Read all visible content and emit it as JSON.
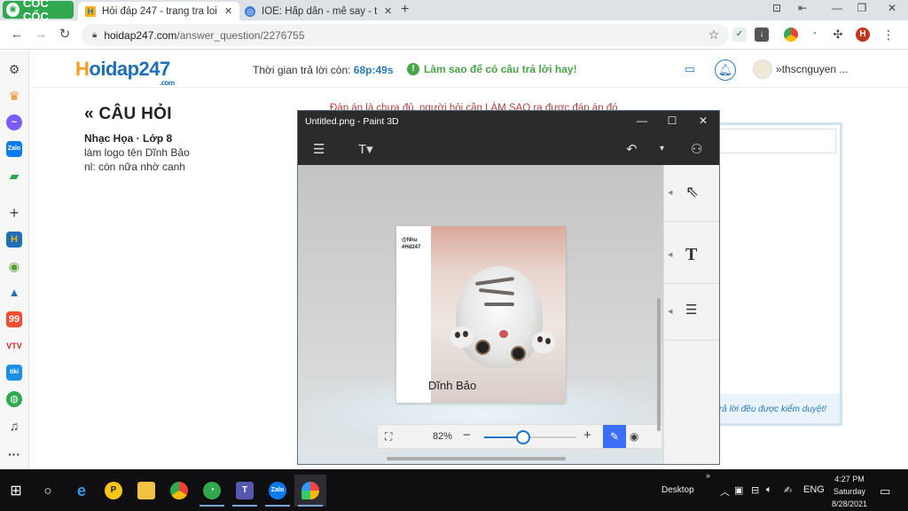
{
  "browser": {
    "brand": "CỐC CỐC",
    "tabs": [
      {
        "title": "Hỏi đáp 247 - trang tra loi",
        "active": true
      },
      {
        "title": "IOE: Hấp dẫn - mê say - thấy",
        "active": false
      }
    ],
    "url_host": "hoidap247.com",
    "url_path": "/answer_question/2276755",
    "profile_initial": "H"
  },
  "site": {
    "logo_h": "H",
    "logo_rest": "oidap247",
    "logo_domain": ".com",
    "timer_label": "Thời gian trả lời còn: ",
    "timer_value": "68p:49s",
    "howto": "Làm sao để có câu trả lời hay!",
    "username": "thscnguyen ..."
  },
  "question": {
    "heading": "CÂU HỎI",
    "meta": "Nhạc Họa · Lớp 8",
    "line1": "làm logo tên Dĩnh Bảo",
    "line2": "nl: còn nữa nhờ canh"
  },
  "answer": {
    "note": "Đáp án là chưa đủ, người hỏi cần LÀM SAO ra được đáp án đó",
    "footer": "trả lời đều được kiểm duyệt!"
  },
  "paint3d": {
    "title": "Untitled.png - Paint 3D",
    "artwork_tag_line1": "@Nhu",
    "artwork_tag_line2": "#Hd247",
    "artwork_name": "Dĩnh Bảo",
    "zoom_text": "82%",
    "zoom_level": 0.42
  },
  "taskbar": {
    "desktop_label": "Desktop",
    "lang": "ENG",
    "time": "4:27 PM",
    "day": "Saturday",
    "date": "8/28/2021"
  }
}
